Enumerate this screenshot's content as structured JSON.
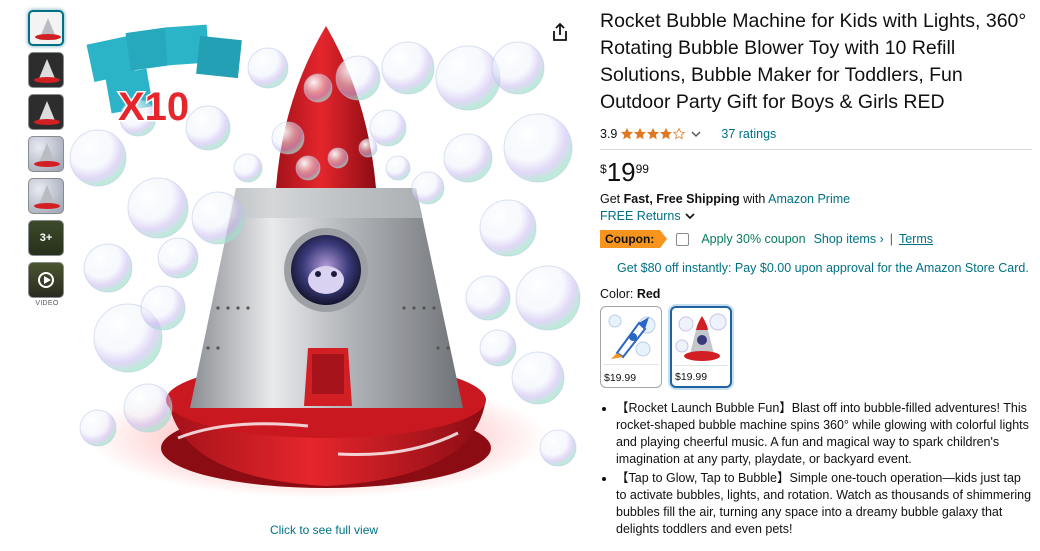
{
  "product": {
    "title": "Rocket Bubble Machine for Kids with Lights, 360° Rotating Bubble Blower Toy with 10 Refill Solutions, Bubble Maker for Toddlers, Fun Outdoor Party Gift for Boys & Girls RED",
    "rating": "3.9",
    "rating_stars": 3.9,
    "ratings_count": "37 ratings",
    "price": {
      "symbol": "$",
      "whole": "19",
      "fraction": "99"
    },
    "shipping": {
      "prefix": "Get ",
      "bold": "Fast, Free Shipping",
      "mid": " with ",
      "link": "Amazon Prime"
    },
    "returns": "FREE Returns",
    "coupon": {
      "tag": "Coupon:",
      "text": "Apply 30% coupon",
      "shop_items": "Shop items ›",
      "separator": "|",
      "terms": "Terms"
    },
    "store_offer": "Get $80 off instantly: Pay $0.00 upon approval for the Amazon Store Card.",
    "color": {
      "label": "Color: ",
      "value": "Red"
    },
    "swatches": [
      {
        "price": "$19.99"
      },
      {
        "price": "$19.99"
      }
    ],
    "bullets": [
      "【Rocket Launch Bubble Fun】Blast off into bubble-filled adventures! This rocket-shaped bubble machine spins 360° while glowing with colorful lights and playing cheerful music. A fun and magical way to spark children's imagination at any party, playdate, or backyard event.",
      "【Tap to Glow, Tap to Bubble】Simple one-touch operation—kids just tap to activate bubbles, lights, and rotation. Watch as thousands of shimmering bubbles fill the air, turning any space into a dreamy bubble galaxy that delights toddlers and even pets!"
    ]
  },
  "gallery": {
    "more_label": "3+",
    "video_label": "VIDEO",
    "click_full_view": "Click to see full view",
    "main_image_overlay": "X10"
  },
  "colors": {
    "link": "#007185",
    "star": "#de7921",
    "coupon_bg": "#f7941d",
    "coupon_text": "#067d62",
    "rocket_red": "#d21f24"
  }
}
